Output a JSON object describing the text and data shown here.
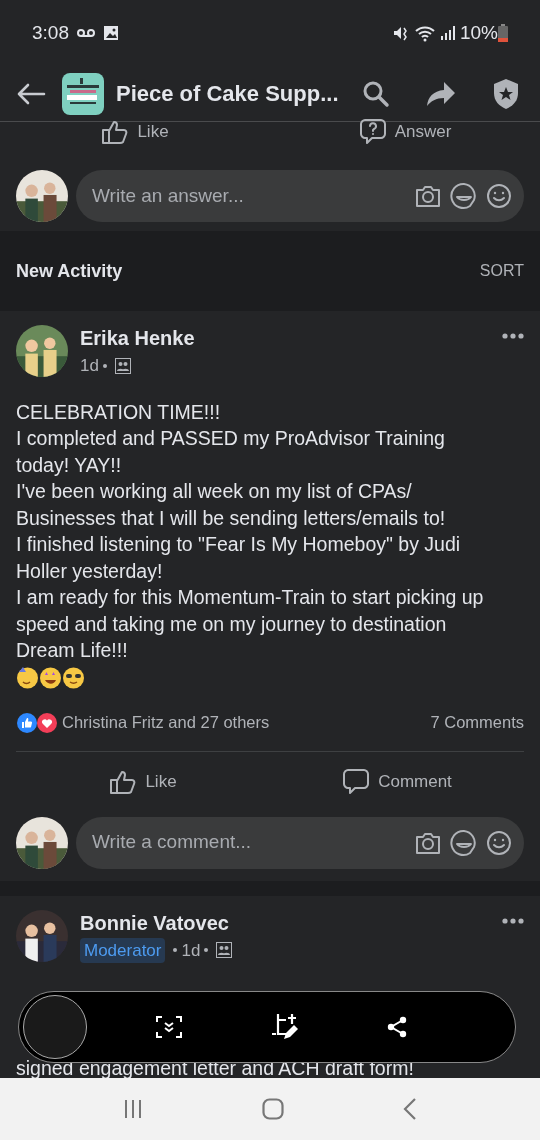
{
  "status_bar": {
    "time": "3:08",
    "battery": "10%"
  },
  "header": {
    "title": "Piece of Cake Supp..."
  },
  "question_actions": [
    {
      "kind": "like",
      "label": "Like"
    },
    {
      "kind": "answer",
      "label": "Answer"
    }
  ],
  "answer_composer": {
    "placeholder": "Write an answer..."
  },
  "section": {
    "title": "New Activity",
    "sort": "SORT"
  },
  "posts": [
    {
      "author": "Erika Henke",
      "meta": "1d",
      "body": "CELEBRATION TIME!!!\nI completed and PASSED my ProAdvisor Training today! YAY!!\nI've been working all week on my list of CPAs/ Businesses that I will be sending letters/emails to!\nI finished listening to \"Fear Is My Homeboy\" by Judi Holler yesterday!\nI am ready for this Momentum-Train to start picking up speed and taking me on my journey to destination Dream Life!!!",
      "reactions": "Christina Fritz and 27 others",
      "comments": "7 Comments",
      "actions": [
        {
          "kind": "like",
          "label": "Like"
        },
        {
          "kind": "comment",
          "label": "Comment"
        }
      ],
      "composer": {
        "placeholder": "Write a comment..."
      }
    },
    {
      "author": "Bonnie Vatovec",
      "badge": "Moderator",
      "meta": "1d",
      "body": "signed engagement letter and ACH draft form!"
    }
  ]
}
